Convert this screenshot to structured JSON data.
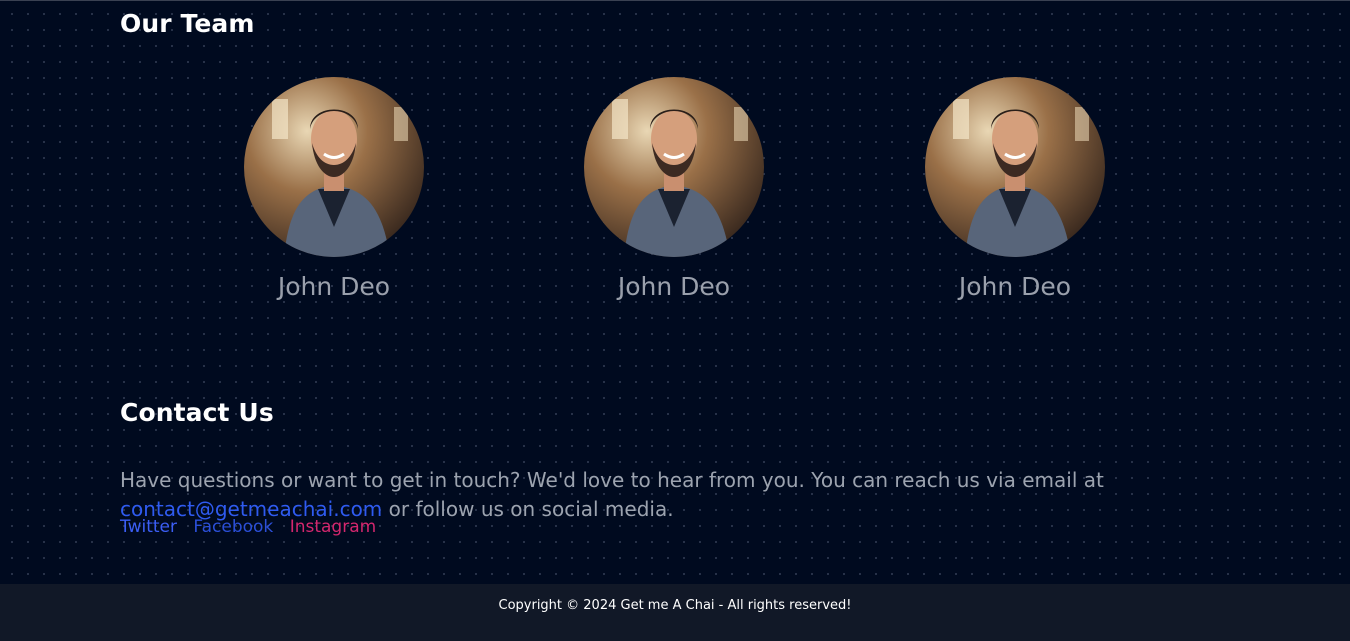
{
  "team": {
    "title": "Our Team",
    "members": [
      {
        "name": "John Deo"
      },
      {
        "name": "John Deo"
      },
      {
        "name": "John Deo"
      }
    ]
  },
  "contact": {
    "title": "Contact Us",
    "text_before": "Have questions or want to get in touch? We'd love to hear from you. You can reach us via email at ",
    "email": "contact@getmeachai.com",
    "text_after": " or follow us on social media."
  },
  "socials": [
    {
      "label": "Twitter",
      "color": "#3b5ef5"
    },
    {
      "label": "Facebook",
      "color": "#2b4fd8"
    },
    {
      "label": "Instagram",
      "color": "#d4276e"
    }
  ],
  "footer": {
    "copyright": "Copyright © 2024 Get me A Chai - All rights reserved!"
  },
  "colors": {
    "background": "#000a1f",
    "footer_bg": "#111827",
    "link": "#2f5bf0"
  }
}
